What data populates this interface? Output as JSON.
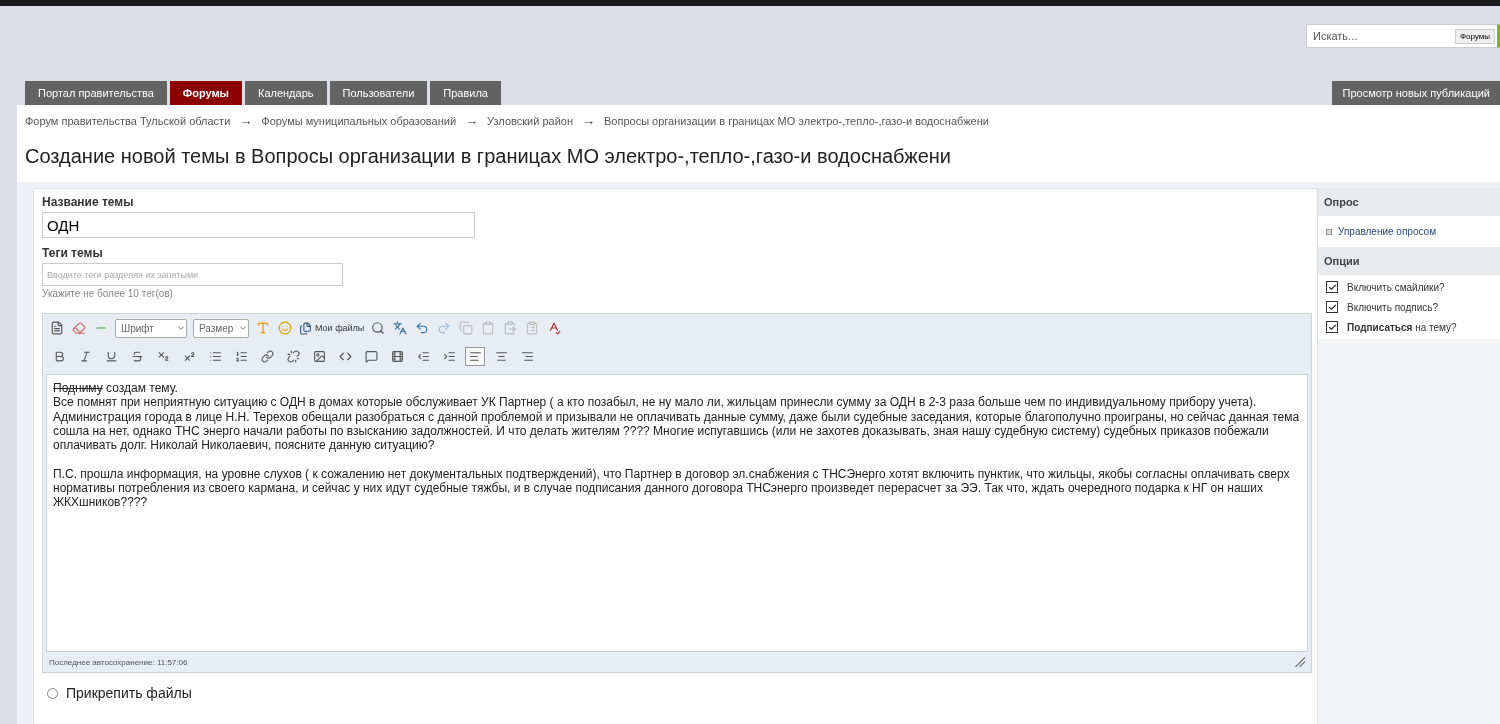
{
  "search": {
    "placeholder": "Искать...",
    "button": "Форумы"
  },
  "tabs": [
    {
      "label": "Портал правительства",
      "selected": false
    },
    {
      "label": "Форумы",
      "selected": true
    },
    {
      "label": "Календарь",
      "selected": false
    },
    {
      "label": "Пользователи",
      "selected": false
    },
    {
      "label": "Правила",
      "selected": false
    }
  ],
  "new_posts_button": "Просмотр новых публикаций",
  "breadcrumbs": [
    "Форум правительства Тульской области",
    "Форумы муниципальных образований",
    "Узловский район",
    "Вопросы организации в границах МО электро-,тепло-,газо-и водоснабжени"
  ],
  "breadcrumb_separator": "→",
  "page_title": "Создание новой темы в Вопросы организации в границах МО электро-,тепло-,газо-и водоснабжени",
  "topic_name": {
    "label": "Название темы",
    "value": "ОДН"
  },
  "topic_tags": {
    "label": "Теги темы",
    "placeholder": "Вводите теги разделяя их запятыми",
    "hint": "Укажите не более 10 тег(ов)"
  },
  "editor": {
    "font_select": "Шрифт",
    "size_select": "Размер",
    "my_files": "Мои файлы",
    "format_buttons": [
      {
        "kind": "bold",
        "selected": false
      },
      {
        "kind": "italic",
        "selected": false
      },
      {
        "kind": "underline",
        "selected": false
      },
      {
        "kind": "strike",
        "selected": false
      },
      {
        "kind": "subscript",
        "selected": false
      },
      {
        "kind": "superscript",
        "selected": false
      },
      {
        "kind": "bullets",
        "selected": false
      },
      {
        "kind": "numbers",
        "selected": false
      },
      {
        "kind": "link",
        "selected": false
      },
      {
        "kind": "unlink",
        "selected": false
      },
      {
        "kind": "image",
        "selected": false
      },
      {
        "kind": "code",
        "selected": false
      },
      {
        "kind": "quote",
        "selected": false
      },
      {
        "kind": "video",
        "selected": false
      },
      {
        "kind": "outdent",
        "selected": false
      },
      {
        "kind": "indent",
        "selected": false
      },
      {
        "kind": "align-left",
        "selected": true
      },
      {
        "kind": "align-center",
        "selected": false
      },
      {
        "kind": "align-right",
        "selected": false
      }
    ],
    "content": [
      {
        "kind": "first",
        "struck": "Подниму",
        "text": "  создам тему."
      },
      {
        "kind": "text",
        "text": "Все помнят при неприятную ситуацию с ОДН в домах которые обслуживает УК Партнер ( а кто позабыл, не ну мало ли, жильцам принесли сумму за ОДН в 2-3 раза больше чем по индивидуальному прибору учета)."
      },
      {
        "kind": "text",
        "text": "Администрация города в лице Н.Н. Терехов обещали разобраться с данной проблемой и призывали не оплачивать данные сумму, даже были судебные заседания, которые благополучно проиграны, но сейчас данная тема сошла на нет, однако  ТНС энерго начали работы по взысканию задолжностей. И что делать жителям ???? Многие испугавшись (или не захотев доказывать, зная нашу судебную систему) судебных приказов побежали оплачивать долг. Николай Николаевич, поясните данную ситуацию?"
      },
      {
        "kind": "blank"
      },
      {
        "kind": "text",
        "text": "П.С. прошла информация, на уровне слухов ( к сожалению нет документальных подтверждений), что Партнер в договор эл.снабжения с ТНСЭнерго хотят включить пунктик, что жильцы, якобы согласны оплачивать сверх нормативы потребления из своего кармана, и сейчас у них идут судебные тяжбы, и в случае подписания данного договора ТНСэнерго произведет перерасчет за ЭЭ. Так что, ждать очередного подарка к НГ он наших ЖКХшников????"
      }
    ],
    "autosave": "Последнее автосохранение: 11:57:06"
  },
  "attach_files": "Прикрепить файлы",
  "sidebar": {
    "poll_heading": "Опрос",
    "poll_link": "Управление опросом",
    "options_heading": "Опции",
    "options": [
      {
        "label": "Включить смайлики?",
        "checked": true
      },
      {
        "label": "Включить подпись?",
        "checked": true
      },
      {
        "label": "**Подписаться** на тему?",
        "checked": true
      }
    ]
  }
}
